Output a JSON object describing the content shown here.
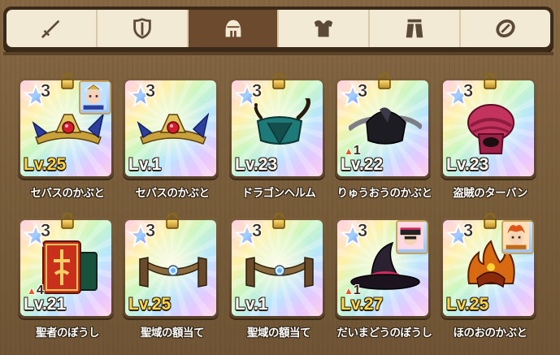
{
  "tabs": [
    {
      "icon": "sword-icon"
    },
    {
      "icon": "shield-icon"
    },
    {
      "icon": "helmet-icon",
      "active": true
    },
    {
      "icon": "armor-top-icon"
    },
    {
      "icon": "armor-bottom-icon"
    },
    {
      "icon": "accessory-ring-icon"
    }
  ],
  "colors": {
    "active_tab": "#6b4a2e",
    "level_normal": "#ffffff",
    "level_max": "#ffd84a"
  },
  "items": [
    {
      "rarity": "3",
      "level": "Lv.25",
      "level_max": true,
      "name": "セバスのかぶと",
      "locked": true,
      "equipped_avatar": true,
      "plus": "",
      "art": "tiara-blue"
    },
    {
      "rarity": "3",
      "level": "Lv.1",
      "level_max": false,
      "name": "セバスのかぶと",
      "locked": false,
      "equipped_avatar": false,
      "plus": "",
      "art": "tiara-blue"
    },
    {
      "rarity": "3",
      "level": "Lv.23",
      "level_max": false,
      "name": "ドラゴンヘルム",
      "locked": true,
      "equipped_avatar": false,
      "plus": "",
      "art": "dragon-helm"
    },
    {
      "rarity": "3",
      "level": "Lv.22",
      "level_max": false,
      "name": "りゅうおうのかぶと",
      "locked": true,
      "equipped_avatar": false,
      "plus": "1",
      "art": "dragonlord-helm"
    },
    {
      "rarity": "3",
      "level": "Lv.23",
      "level_max": false,
      "name": "盗賊のターバン",
      "locked": true,
      "equipped_avatar": false,
      "plus": "",
      "art": "turban"
    },
    {
      "rarity": "3",
      "level": "Lv.21",
      "level_max": false,
      "name": "聖者のぼうし",
      "locked": true,
      "equipped_avatar": false,
      "plus": "4",
      "art": "saint-hat"
    },
    {
      "rarity": "3",
      "level": "Lv.25",
      "level_max": true,
      "name": "聖域の額当て",
      "locked": true,
      "equipped_avatar": false,
      "plus": "",
      "art": "circlet"
    },
    {
      "rarity": "3",
      "level": "Lv.1",
      "level_max": false,
      "name": "聖域の額当て",
      "locked": true,
      "equipped_avatar": false,
      "plus": "",
      "art": "circlet"
    },
    {
      "rarity": "3",
      "level": "Lv.27",
      "level_max": true,
      "name": "だいまどうのぼうし",
      "locked": false,
      "equipped_avatar": true,
      "plus": "1",
      "art": "witch-hat"
    },
    {
      "rarity": "3",
      "level": "Lv.25",
      "level_max": true,
      "name": "ほのおのかぶと",
      "locked": true,
      "equipped_avatar": true,
      "plus": "",
      "art": "flame-helm"
    }
  ]
}
